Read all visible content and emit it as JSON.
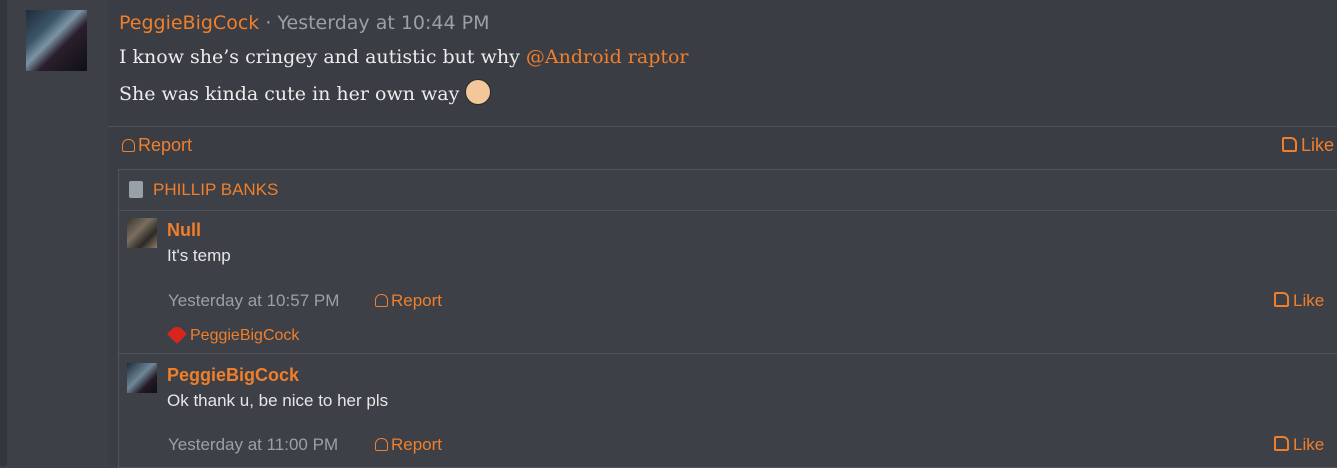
{
  "post": {
    "author": "PeggieBigCock",
    "separator": "·",
    "timestamp": "Yesterday at 10:44 PM",
    "line1_text": "I know she’s cringey and autistic but why ",
    "line1_mention": "@Android raptor",
    "line2_text": "She was kinda cute in her own way",
    "emoji_icon": "frowning-face-emoji",
    "report_label": "Report",
    "like_label": "Like"
  },
  "thread": {
    "title": "PHILLIP BANKS",
    "replies": [
      {
        "author": "Null",
        "text": "It's temp",
        "timestamp": "Yesterday at 10:57 PM",
        "report_label": "Report",
        "like_label": "Like",
        "reaction_user": "PeggieBigCock"
      },
      {
        "author": "PeggieBigCock",
        "text": "Ok thank u, be nice to her pls",
        "timestamp": "Yesterday at 11:00 PM",
        "report_label": "Report",
        "like_label": "Like"
      }
    ]
  },
  "colors": {
    "accent": "#f07f2b",
    "background": "#3a3d44",
    "muted_text": "#9aa0a8"
  }
}
